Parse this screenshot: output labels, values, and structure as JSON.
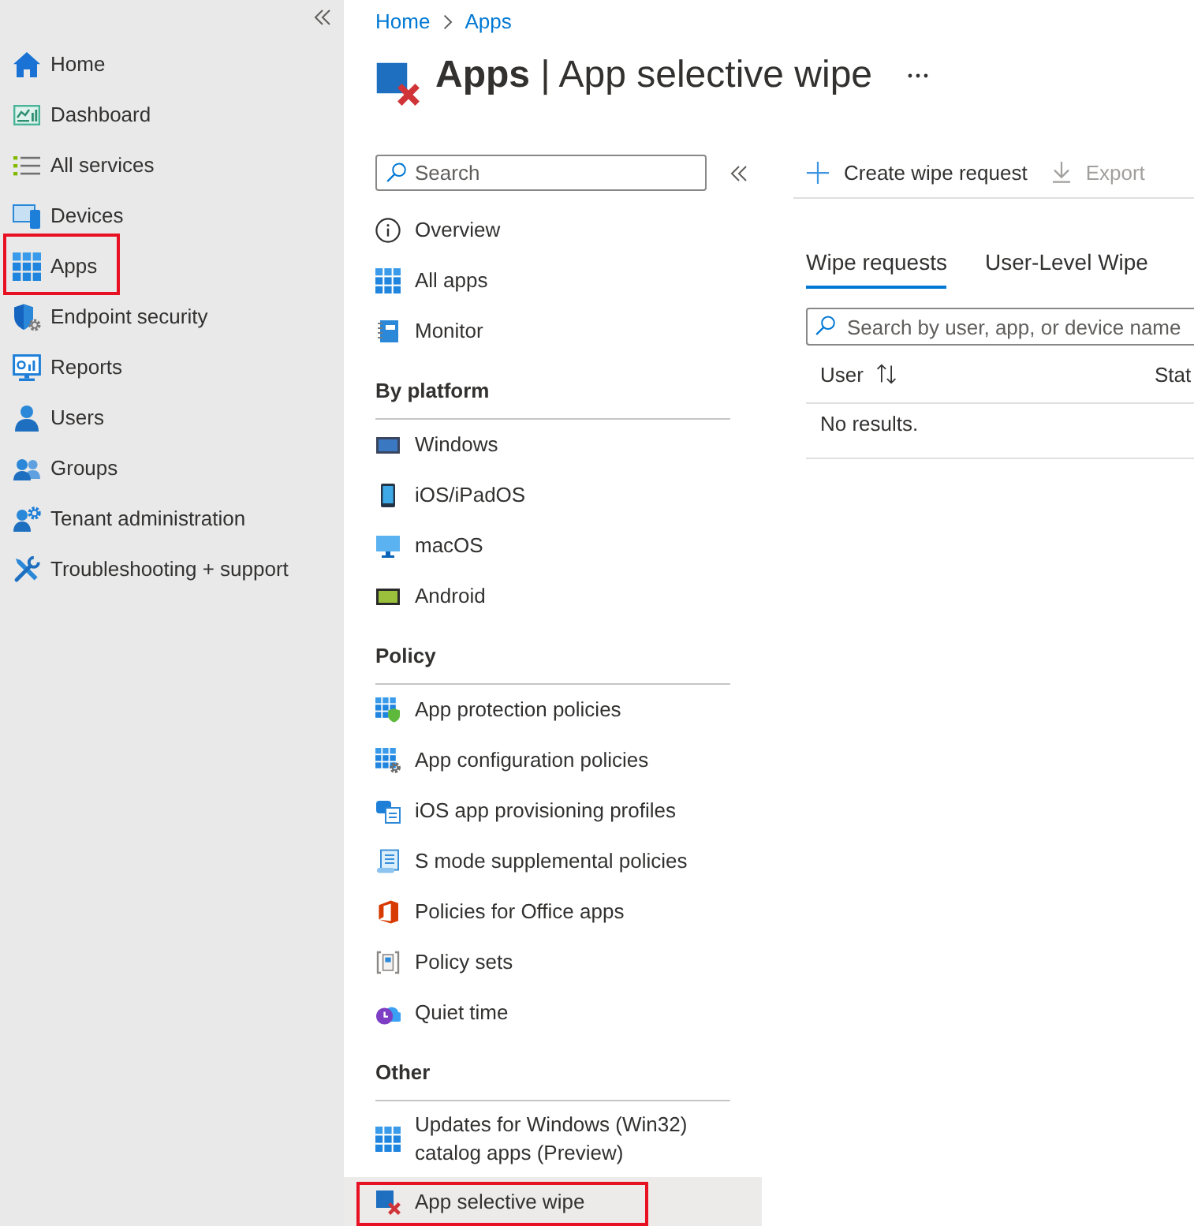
{
  "sidebar": {
    "items": [
      {
        "label": "Home",
        "highlighted": false
      },
      {
        "label": "Dashboard",
        "highlighted": false
      },
      {
        "label": "All services",
        "highlighted": false
      },
      {
        "label": "Devices",
        "highlighted": false
      },
      {
        "label": "Apps",
        "highlighted": true
      },
      {
        "label": "Endpoint security",
        "highlighted": false
      },
      {
        "label": "Reports",
        "highlighted": false
      },
      {
        "label": "Users",
        "highlighted": false
      },
      {
        "label": "Groups",
        "highlighted": false
      },
      {
        "label": "Tenant administration",
        "highlighted": false
      },
      {
        "label": "Troubleshooting + support",
        "highlighted": false
      }
    ]
  },
  "breadcrumb": [
    {
      "label": "Home"
    },
    {
      "label": "Apps"
    }
  ],
  "title": "**Apps** | App selective wipe",
  "menu": {
    "search": {
      "placeholder": "Search"
    },
    "sections": [
      {
        "items": [
          {
            "label": "Overview",
            "selected": false,
            "highlighted": false
          },
          {
            "label": "All apps",
            "selected": false,
            "highlighted": false
          },
          {
            "label": "Monitor",
            "selected": false,
            "highlighted": false
          }
        ]
      },
      {
        "heading": "By platform",
        "items": [
          {
            "label": "Windows",
            "selected": false,
            "highlighted": false
          },
          {
            "label": "iOS/iPadOS",
            "selected": false,
            "highlighted": false
          },
          {
            "label": "macOS",
            "selected": false,
            "highlighted": false
          },
          {
            "label": "Android",
            "selected": false,
            "highlighted": false
          }
        ]
      },
      {
        "heading": "Policy",
        "items": [
          {
            "label": "App protection policies",
            "selected": false,
            "highlighted": false
          },
          {
            "label": "App configuration policies",
            "selected": false,
            "highlighted": false
          },
          {
            "label": "iOS app provisioning profiles",
            "selected": false,
            "highlighted": false
          },
          {
            "label": "S mode supplemental policies",
            "selected": false,
            "highlighted": false
          },
          {
            "label": "Policies for Office apps",
            "selected": false,
            "highlighted": false
          },
          {
            "label": "Policy sets",
            "selected": false,
            "highlighted": false
          },
          {
            "label": "Quiet time",
            "selected": false,
            "highlighted": false
          }
        ]
      },
      {
        "heading": "Other",
        "items": [
          {
            "label": "Updates for Windows (Win32) catalog apps (Preview)",
            "selected": false,
            "highlighted": false
          },
          {
            "label": "App selective wipe",
            "selected": true,
            "highlighted": true
          }
        ]
      }
    ]
  },
  "commands": [
    {
      "label": "Create wipe request",
      "disabled": false
    },
    {
      "label": "Export",
      "disabled": true
    }
  ],
  "tabs": [
    {
      "label": "Wipe requests",
      "selected": true
    },
    {
      "label": "User-Level Wipe",
      "selected": false
    }
  ],
  "filter": {
    "placeholder": "Search by user, app, or device name"
  },
  "table": {
    "columns": [
      {
        "label": "User",
        "sortable": true
      },
      {
        "label": "Stat",
        "sortable": false
      }
    ],
    "empty_message": "No results."
  }
}
